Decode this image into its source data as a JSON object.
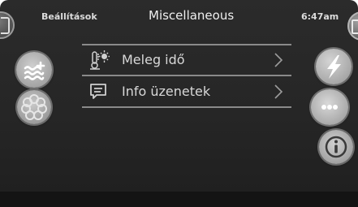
{
  "header": {
    "left_label": "Beállítások",
    "title": "Miscellaneous",
    "time": "6:47am"
  },
  "menu": {
    "items": [
      {
        "label": "Meleg idő",
        "icon": "thermometer-sun-icon"
      },
      {
        "label": "Info üzenetek",
        "icon": "message-icon"
      }
    ]
  },
  "left_buttons": [
    "water-waves-plus-icon",
    "flower-icon"
  ],
  "right_buttons": [
    "lightning-icon",
    "more-dots-icon",
    "info-icon"
  ],
  "colors": {
    "screen_background": "#262626",
    "text": "#d8d8d8",
    "divider": "#8a8a8a",
    "button_face": "#a8a8a8"
  }
}
